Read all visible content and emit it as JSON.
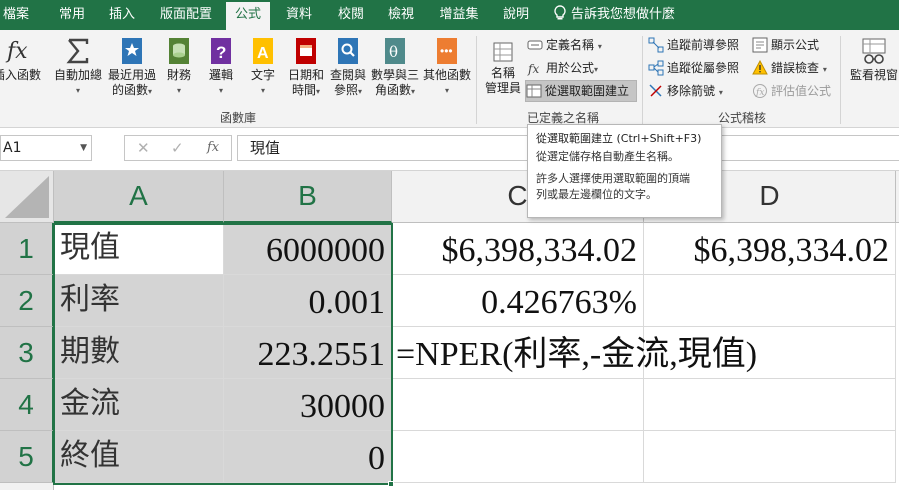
{
  "tabs": [
    {
      "label": "檔案"
    },
    {
      "label": "常用"
    },
    {
      "label": "插入"
    },
    {
      "label": "版面配置"
    },
    {
      "label": "公式"
    },
    {
      "label": "資料"
    },
    {
      "label": "校閱"
    },
    {
      "label": "檢視"
    },
    {
      "label": "增益集"
    },
    {
      "label": "說明"
    }
  ],
  "active_tab": "公式",
  "tell_me": "告訴我您想做什麼",
  "ribbon": {
    "library": {
      "insert_function": "插入函數",
      "autosum": "自動加總",
      "recent_1": "最近用過",
      "recent_2": "的函數",
      "financial": "財務",
      "logical": "邏輯",
      "text": "文字",
      "datetime_1": "日期和",
      "datetime_2": "時間",
      "lookup_1": "查閱與",
      "lookup_2": "參照",
      "math_1": "數學與三",
      "math_2": "角函數",
      "more": "其他函數",
      "group_label": "函數庫"
    },
    "names": {
      "manager_1": "名稱",
      "manager_2": "管理員",
      "define_name": "定義名稱",
      "use_in_formula": "用於公式",
      "create_from_selection": "從選取範圍建立",
      "group_label": "已定義之名稱"
    },
    "auditing": {
      "trace_precedents": "追蹤前導參照",
      "trace_dependents": "追蹤從屬參照",
      "remove_arrows": "移除箭號",
      "show_formulas": "顯示公式",
      "error_checking": "錯誤檢查",
      "evaluate_formula": "評估值公式",
      "group_label": "公式稽核"
    },
    "watch": {
      "watch_window": "監看視窗"
    }
  },
  "tooltip": {
    "title": "從選取範圍建立 (Ctrl+Shift+F3)",
    "line1": "從選定儲存格自動產生名稱。",
    "line2": "許多人選擇使用選取範圍的頂端",
    "line3": "列或最左邊欄位的文字。"
  },
  "formula_bar": {
    "name_box": "A1",
    "cancel_glyph": "✕",
    "enter_glyph": "✓",
    "fx_glyph": "fx",
    "content": "現值"
  },
  "columns": [
    "A",
    "B",
    "C",
    "D"
  ],
  "rows": [
    "1",
    "2",
    "3",
    "4",
    "5"
  ],
  "cells": {
    "A1": "現值",
    "B1": "6000000",
    "C1": "$6,398,334.02",
    "D1": "$6,398,334.02",
    "A2": "利率",
    "B2": "0.001",
    "C2": "0.426763%",
    "A3": "期數",
    "B3": "223.2551",
    "C3": "=NPER(利率,-金流,現值)",
    "A4": "金流",
    "B4": "30000",
    "A5": "終值",
    "B5": "0"
  },
  "colors": {
    "accent": "#217346",
    "selection_shade": "#d4d4d4",
    "ribbon_bg": "#f3f3f3"
  }
}
